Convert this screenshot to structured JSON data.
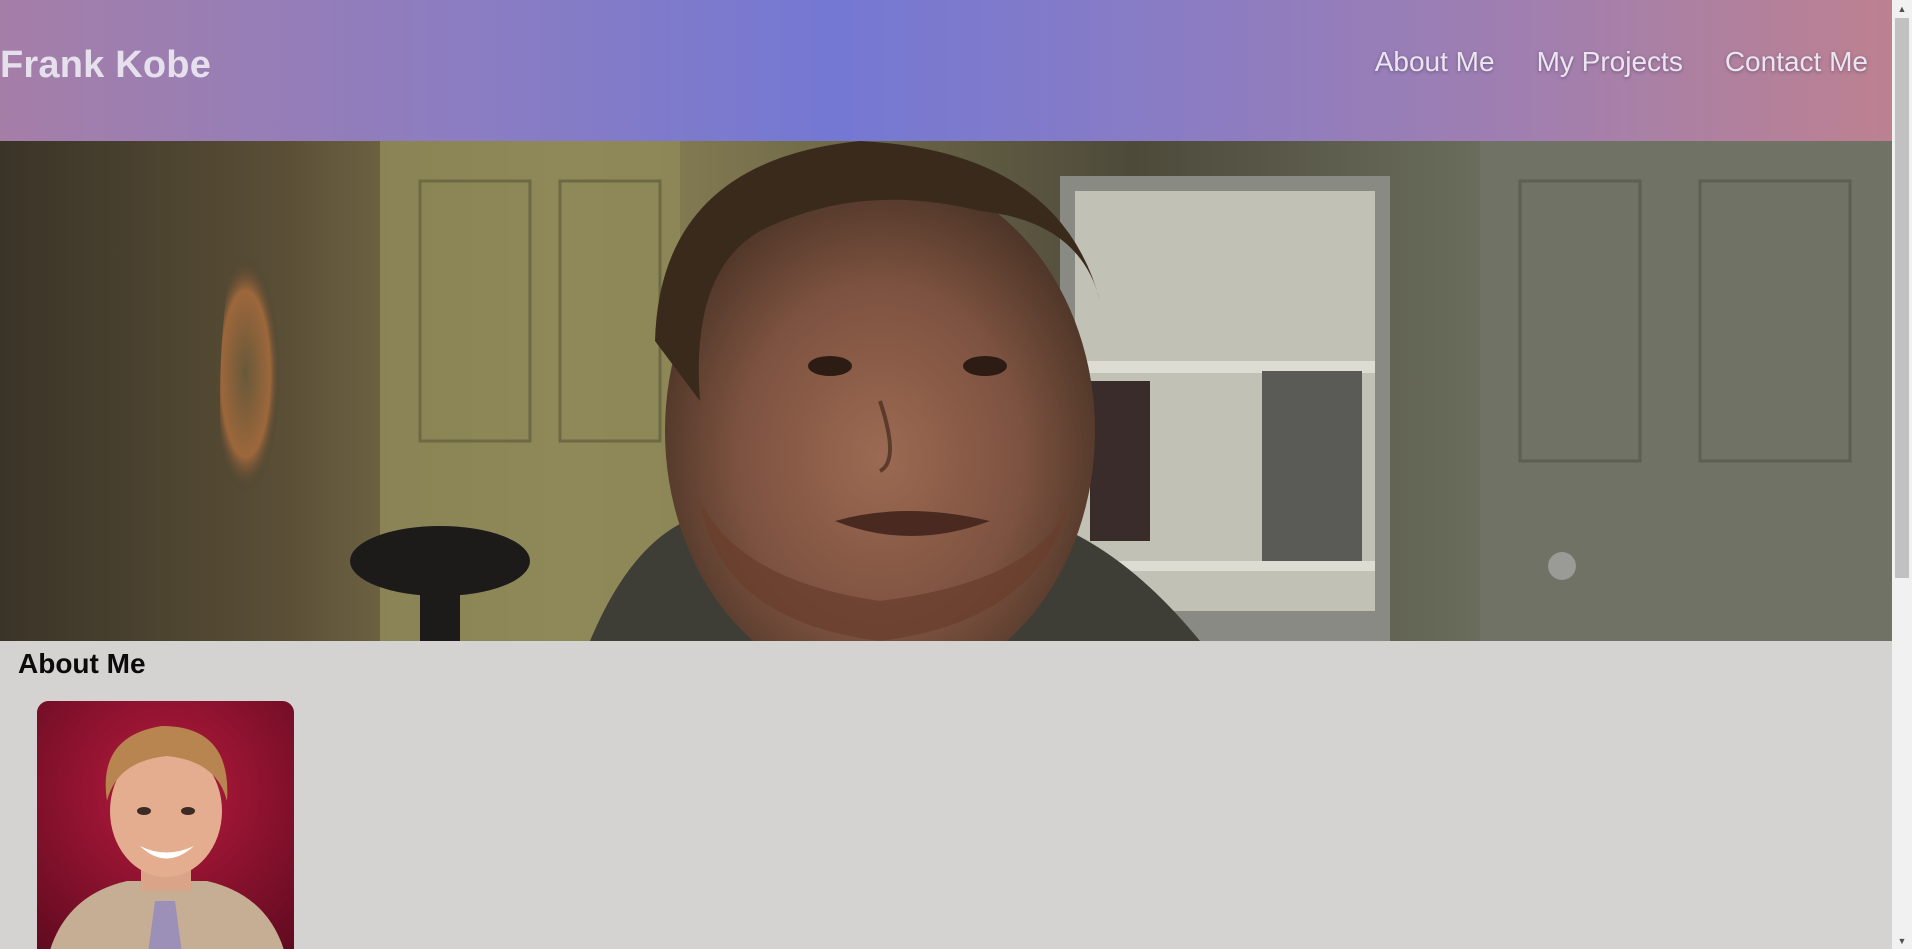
{
  "header": {
    "site_title": "Frank Kobe",
    "nav": [
      {
        "label": "About Me"
      },
      {
        "label": "My Projects"
      },
      {
        "label": "Contact Me"
      }
    ]
  },
  "hero": {
    "image": "video-frame-of-man-in-room"
  },
  "about": {
    "heading": "About Me",
    "portrait": "headshot-photo"
  },
  "scrollbar": {
    "up_icon": "triangle-up-icon",
    "down_icon": "triangle-down-icon"
  }
}
